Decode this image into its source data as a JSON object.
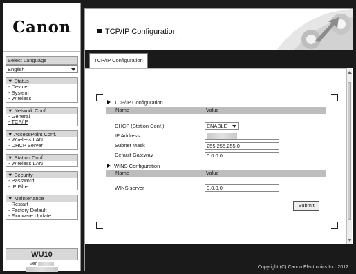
{
  "brand": {
    "logo": "Canon",
    "model": "WU10",
    "version_label": "Ver"
  },
  "language": {
    "label": "Select Language",
    "selected": "English"
  },
  "sidebar": {
    "groups": [
      {
        "header": "▼ Status",
        "items": [
          "- Device",
          "- System",
          "- Wireless"
        ]
      },
      {
        "header": "▼ Network Conf.",
        "items": [
          "- General",
          "- TCP/IP"
        ]
      },
      {
        "header": "▼ AccessPoint Conf.",
        "items": [
          "- Wireless LAN",
          "- DHCP Server"
        ]
      },
      {
        "header": "▼ Station Conf.",
        "items": [
          "- Wireless LAN"
        ]
      },
      {
        "header": "▼ Security",
        "items": [
          "- Password",
          "- IP Filter"
        ]
      },
      {
        "header": "▼ Maintenance",
        "items": [
          "- Restart",
          "- Factory Default",
          "- Firmware Update"
        ]
      }
    ]
  },
  "page": {
    "title": "TCP/IP Configuration",
    "tab": "TCP/IP Configuration"
  },
  "tcpip": {
    "section_title": "TCP/IP Configuration",
    "col_name": "Name",
    "col_value": "Value",
    "dhcp_label": "DHCP (Station Conf.)",
    "dhcp_value": "ENABLE",
    "ip_label": "IP Address",
    "mask_label": "Subnet Mask",
    "mask_value": "255.255.255.0",
    "gateway_label": "Default Gateway",
    "gateway_value": "0.0.0.0"
  },
  "wins": {
    "section_title": "WINS Configuration",
    "col_name": "Name",
    "col_value": "Value",
    "server_label": "WINS server",
    "server_value": "0.0.0.0"
  },
  "actions": {
    "submit": "Submit"
  },
  "footer": {
    "copyright": "Copyright (C) Canon Electronics Inc. 2012"
  }
}
